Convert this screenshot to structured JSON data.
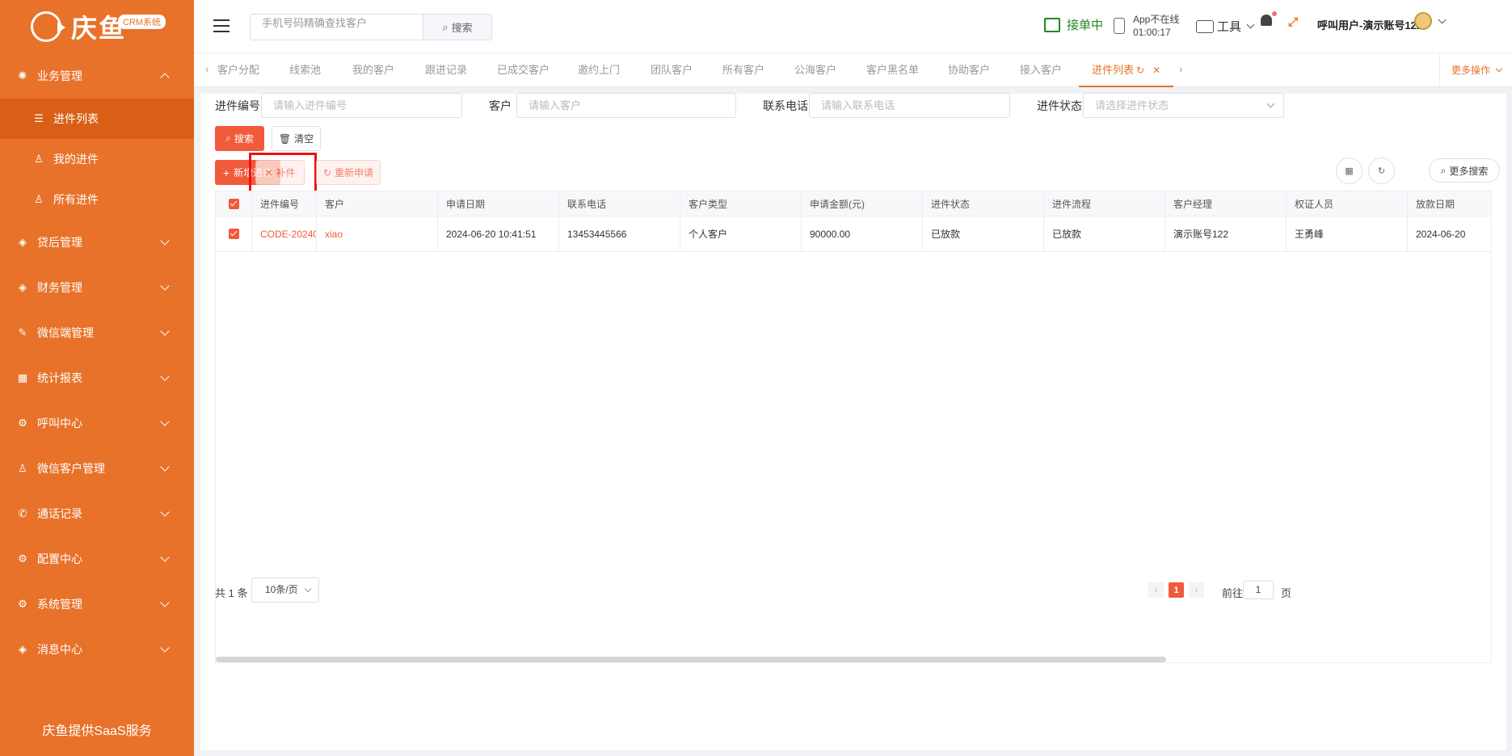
{
  "brand": {
    "logo_text": "庆鱼",
    "badge": "CRM系统",
    "footer": "庆鱼提供SaaS服务"
  },
  "sidebar": {
    "groups": [
      {
        "label": "业务管理",
        "icon": "gear-icon",
        "expanded": true
      },
      {
        "label": "贷后管理",
        "icon": "tag-icon"
      },
      {
        "label": "财务管理",
        "icon": "tag-icon"
      },
      {
        "label": "微信端管理",
        "icon": "edit-icon"
      },
      {
        "label": "统计报表",
        "icon": "table-icon"
      },
      {
        "label": "呼叫中心",
        "icon": "gear-icon"
      },
      {
        "label": "微信客户管理",
        "icon": "user-icon"
      },
      {
        "label": "通话记录",
        "icon": "phone-icon"
      },
      {
        "label": "配置中心",
        "icon": "gear-icon"
      },
      {
        "label": "系统管理",
        "icon": "gear-icon"
      },
      {
        "label": "消息中心",
        "icon": "tag-icon"
      }
    ],
    "subitems": [
      {
        "label": "进件列表",
        "icon": "list-icon",
        "active": true
      },
      {
        "label": "我的进件",
        "icon": "user-icon"
      },
      {
        "label": "所有进件",
        "icon": "user-icon"
      }
    ]
  },
  "header": {
    "search_placeholder": "手机号码精确查找客户",
    "search_button": "搜索",
    "status": "接单中",
    "app_status": "App不在线",
    "app_time": "01:00:17",
    "tools": "工具",
    "user": "呼叫用户-演示账号122"
  },
  "tabs": {
    "items": [
      "客户分配",
      "线索池",
      "我的客户",
      "跟进记录",
      "已成交客户",
      "邀约上门",
      "团队客户",
      "所有客户",
      "公海客户",
      "客户黑名单",
      "协助客户",
      "接入客户"
    ],
    "active": "进件列表",
    "more": "更多操作"
  },
  "filters": {
    "code_label": "进件编号",
    "code_placeholder": "请输入进件编号",
    "customer_label": "客户",
    "customer_placeholder": "请输入客户",
    "phone_label": "联系电话",
    "phone_placeholder": "请输入联系电话",
    "status_label": "进件状态",
    "status_placeholder": "请选择进件状态"
  },
  "actions": {
    "search": "搜索",
    "clear": "清空",
    "add": "新增进件",
    "supplement": "补件",
    "reapply": "重新申请",
    "more_search": "更多搜索"
  },
  "table": {
    "columns": [
      "进件编号",
      "客户",
      "申请日期",
      "联系电话",
      "客户类型",
      "申请金额(元)",
      "进件状态",
      "进件流程",
      "客户经理",
      "权证人员",
      "放款日期"
    ],
    "rows": [
      [
        "CODE-20240",
        "xiao",
        "2024-06-20 10:41:51",
        "13453445566",
        "个人客户",
        "90000.00",
        "已放款",
        "已放款",
        "演示账号122",
        "王勇峰",
        "2024-06-20"
      ]
    ]
  },
  "pagination": {
    "total": "共 1 条",
    "page_size": "10条/页",
    "current_page": "1",
    "goto_prefix": "前往",
    "goto_value": "1",
    "goto_suffix": "页"
  },
  "colors": {
    "accent": "#e8722a",
    "primary": "#f15a3a",
    "online": "#1f8a1f"
  }
}
